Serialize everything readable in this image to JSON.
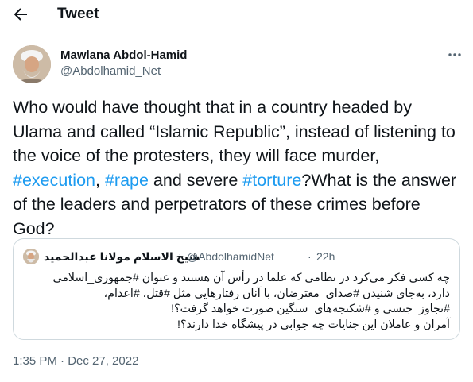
{
  "header": {
    "title": "Tweet",
    "back_icon": "arrow-left-icon"
  },
  "author": {
    "name": "Mawlana Abdol-Hamid",
    "handle": "@Abdolhamid_Net"
  },
  "tweet": {
    "text_1": "Who would have thought that in a country headed by Ulama and called “Islamic Republic”, instead of listening to the voice of the protesters, they will face murder, ",
    "tag_1": "#execution",
    "text_2": ", ",
    "tag_2": "#rape",
    "text_3": " and severe ",
    "tag_3": "#torture",
    "text_4": "?What is the answer of the leaders and perpetrators of these crimes before God?",
    "timestamp": "1:35 PM · Dec 27, 2022"
  },
  "quoted": {
    "name": "شیخ الاسلام مولانا عبدالحمید",
    "handle": "@AbdolhamidNet",
    "separator": "·",
    "time": "22h",
    "lines": [
      "چه کسی فکر می‌کرد در نظامی که علما در رأس آن هستند و عنوان #جمهوری_اسلامی",
      "دارد، به‌جای شنیدن #صدای_معترضان، با آنان رفتارهایی مثل #قتل، #اعدام،",
      "#تجاوز_جنسی و #شکنجه‌های_سنگین صورت خواهد گرفت؟!",
      "آمران و عاملان این جنایات چه جوابی در پیشگاه خدا دارند؟!"
    ]
  },
  "colors": {
    "link": "#1d9bf0",
    "text": "#0f1419",
    "secondary": "#536471",
    "border": "#cfd9de"
  }
}
